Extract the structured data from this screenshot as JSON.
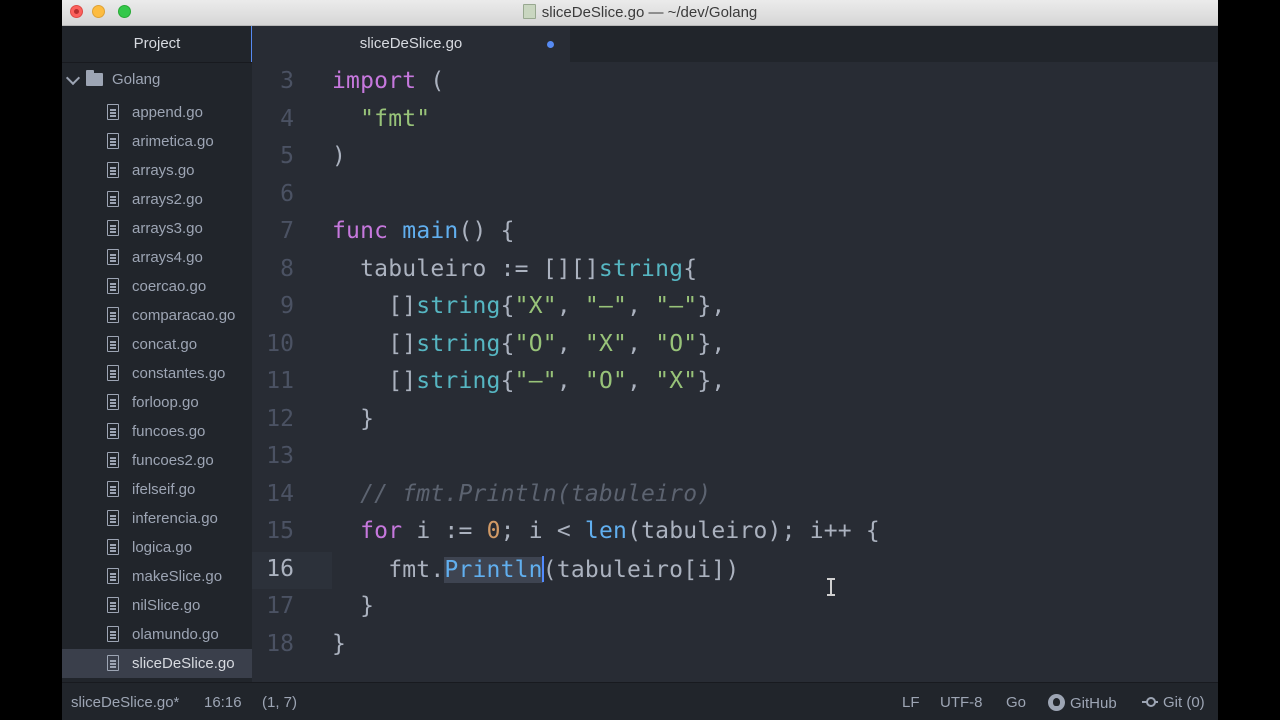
{
  "window": {
    "title": "sliceDeSlice.go — ~/dev/Golang"
  },
  "sidebar": {
    "header": "Project",
    "folder": "Golang",
    "files": [
      "append.go",
      "arimetica.go",
      "arrays.go",
      "arrays2.go",
      "arrays3.go",
      "arrays4.go",
      "coercao.go",
      "comparacao.go",
      "concat.go",
      "constantes.go",
      "forloop.go",
      "funcoes.go",
      "funcoes2.go",
      "ifelseif.go",
      "inferencia.go",
      "logica.go",
      "makeSlice.go",
      "nilSlice.go",
      "olamundo.go",
      "sliceDeSlice.go"
    ],
    "active_file": "sliceDeSlice.go"
  },
  "tab": {
    "label": "sliceDeSlice.go",
    "modified": true
  },
  "editor": {
    "current_line": 16,
    "lines": [
      {
        "n": "3",
        "text": "import ("
      },
      {
        "n": "4",
        "text": "  \"fmt\""
      },
      {
        "n": "5",
        "text": ")"
      },
      {
        "n": "6",
        "text": ""
      },
      {
        "n": "7",
        "text": "func main() {"
      },
      {
        "n": "8",
        "text": "  tabuleiro := [][]string{"
      },
      {
        "n": "9",
        "text": "    []string{\"X\", \"–\", \"–\"},"
      },
      {
        "n": "10",
        "text": "    []string{\"O\", \"X\", \"O\"},"
      },
      {
        "n": "11",
        "text": "    []string{\"–\", \"O\", \"X\"},"
      },
      {
        "n": "12",
        "text": "  }"
      },
      {
        "n": "13",
        "text": ""
      },
      {
        "n": "14",
        "text": "  // fmt.Println(tabuleiro)"
      },
      {
        "n": "15",
        "text": "  for i := 0; i < len(tabuleiro); i++ {"
      },
      {
        "n": "16",
        "text": "    fmt.Println(tabuleiro[i])"
      },
      {
        "n": "17",
        "text": "  }"
      },
      {
        "n": "18",
        "text": "}"
      }
    ]
  },
  "statusbar": {
    "file": "sliceDeSlice.go*",
    "cursor_position": "16:16",
    "selection": "(1, 7)",
    "line_ending": "LF",
    "encoding": "UTF-8",
    "grammar": "Go",
    "github": "GitHub",
    "git": "Git (0)"
  },
  "colors": {
    "background": "#282c34",
    "sidebar": "#21252b",
    "keyword": "#c678dd",
    "function": "#61afef",
    "type": "#56b6c2",
    "string": "#98c379",
    "number": "#d19a66",
    "comment": "#5c6370",
    "accent": "#568af2"
  }
}
